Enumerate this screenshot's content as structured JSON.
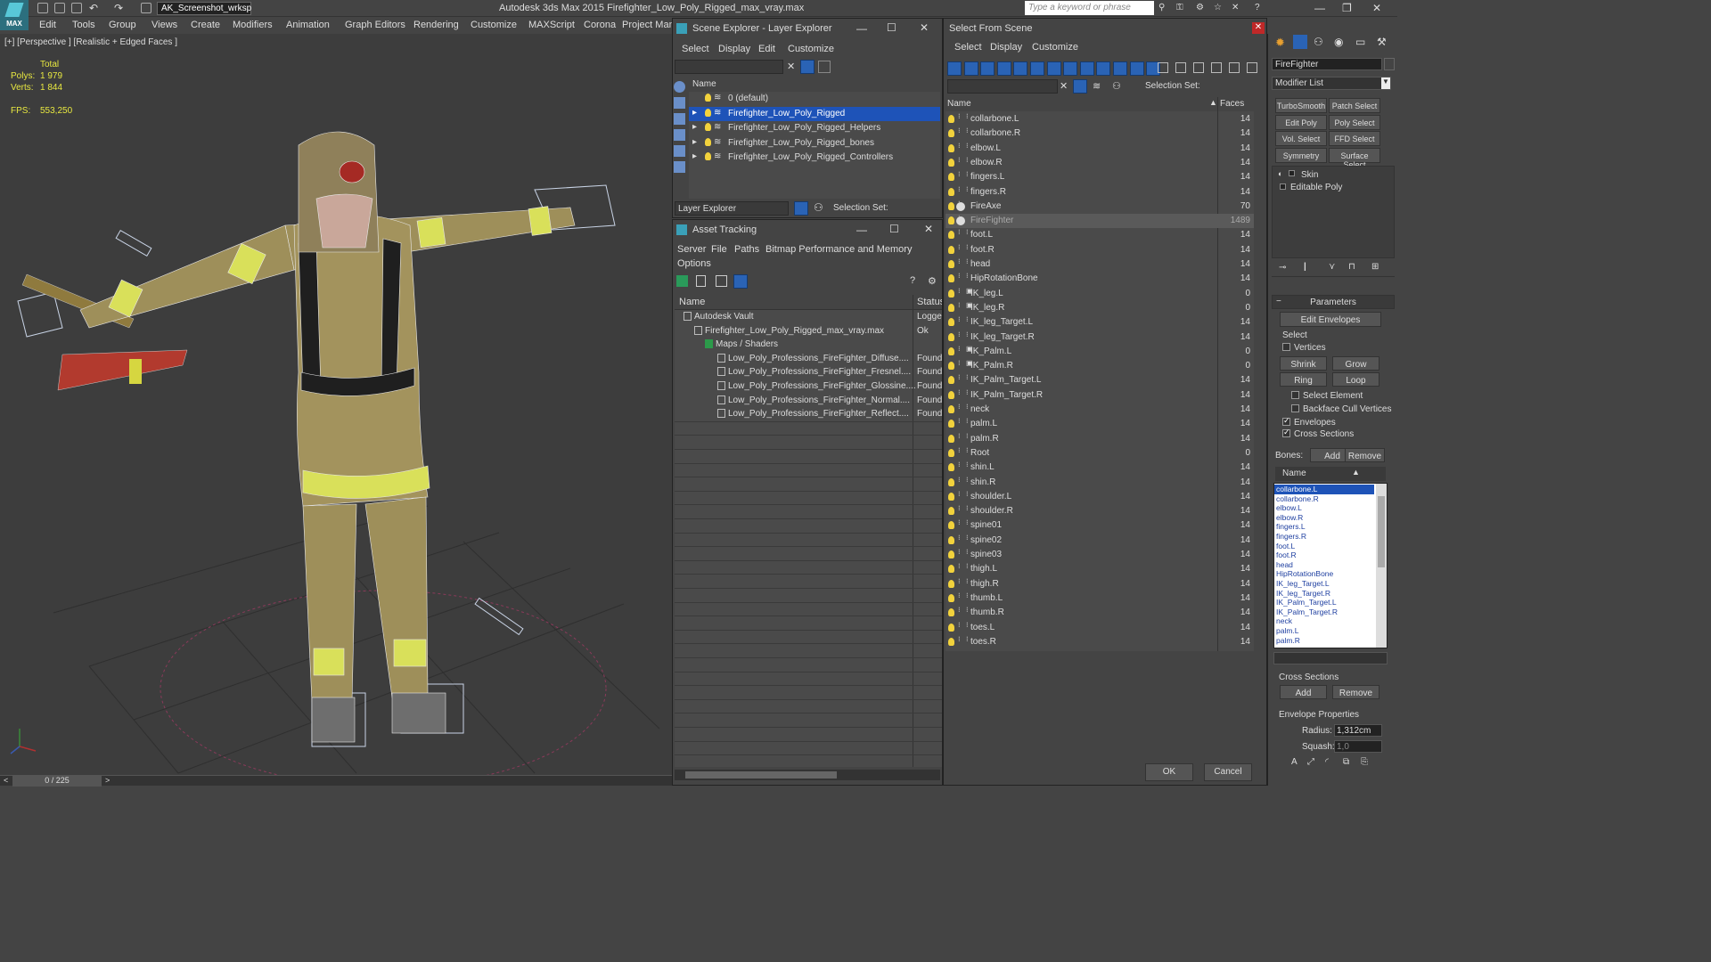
{
  "app": {
    "title": "Autodesk 3ds Max  2015     Firefighter_Low_Poly_Rigged_max_vray.max",
    "workspace": "AK_Screenshot_wrksp",
    "search_placeholder": "Type a keyword or phrase",
    "logo": "MAX"
  },
  "menu": [
    "Edit",
    "Tools",
    "Group",
    "Views",
    "Create",
    "Modifiers",
    "Animation",
    "Graph Editors",
    "Rendering",
    "Customize",
    "MAXScript",
    "Corona",
    "Project Man"
  ],
  "viewport": {
    "label": "[+] [Perspective ] [Realistic + Edged Faces ]",
    "total_label": "Total",
    "polys_label": "Polys:",
    "polys_value": "1 979",
    "verts_label": "Verts:",
    "verts_value": "1 844",
    "fps_label": "FPS:",
    "fps_value": "553,250"
  },
  "timeline": {
    "frame": "0 / 225",
    "prev": "<",
    "next": ">"
  },
  "scene_explorer": {
    "title": "Scene Explorer - Layer Explorer",
    "menu": [
      "Select",
      "Display",
      "Edit",
      "Customize"
    ],
    "column": "Name",
    "layers": [
      "0 (default)",
      "Firefighter_Low_Poly_Rigged",
      "Firefighter_Low_Poly_Rigged_Helpers",
      "Firefighter_Low_Poly_Rigged_bones",
      "Firefighter_Low_Poly_Rigged_Controllers"
    ],
    "footer_dropdown": "Layer Explorer",
    "selection_set": "Selection Set:"
  },
  "asset_tracking": {
    "title": "Asset Tracking",
    "menu": [
      "Server",
      "File",
      "Paths",
      "Bitmap Performance and Memory",
      "Options"
    ],
    "col_name": "Name",
    "col_status": "Status",
    "rows": [
      {
        "name": "Autodesk Vault",
        "status": "Logge"
      },
      {
        "name": "Firefighter_Low_Poly_Rigged_max_vray.max",
        "status": "Ok"
      },
      {
        "name": "Maps / Shaders",
        "status": ""
      },
      {
        "name": "Low_Poly_Professions_FireFighter_Diffuse....",
        "status": "Found"
      },
      {
        "name": "Low_Poly_Professions_FireFighter_Fresnel....",
        "status": "Found"
      },
      {
        "name": "Low_Poly_Professions_FireFighter_Glossine....",
        "status": "Found"
      },
      {
        "name": "Low_Poly_Professions_FireFighter_Normal....",
        "status": "Found"
      },
      {
        "name": "Low_Poly_Professions_FireFighter_Reflect....",
        "status": "Found"
      }
    ]
  },
  "select_from_scene": {
    "title": "Select From Scene",
    "menu": [
      "Select",
      "Display",
      "Customize"
    ],
    "selection_set": "Selection Set:",
    "col_name": "Name",
    "col_faces": "Faces",
    "rows": [
      {
        "name": "collarbone.L",
        "faces": "14"
      },
      {
        "name": "collarbone.R",
        "faces": "14"
      },
      {
        "name": "elbow.L",
        "faces": "14"
      },
      {
        "name": "elbow.R",
        "faces": "14"
      },
      {
        "name": "fingers.L",
        "faces": "14"
      },
      {
        "name": "fingers.R",
        "faces": "14"
      },
      {
        "name": "FireAxe",
        "faces": "70"
      },
      {
        "name": "FireFighter",
        "faces": "1489"
      },
      {
        "name": "foot.L",
        "faces": "14"
      },
      {
        "name": "foot.R",
        "faces": "14"
      },
      {
        "name": "head",
        "faces": "14"
      },
      {
        "name": "HipRotationBone",
        "faces": "14"
      },
      {
        "name": "IK_leg.L",
        "faces": "0"
      },
      {
        "name": "IK_leg.R",
        "faces": "0"
      },
      {
        "name": "IK_leg_Target.L",
        "faces": "14"
      },
      {
        "name": "IK_leg_Target.R",
        "faces": "14"
      },
      {
        "name": "IK_Palm.L",
        "faces": "0"
      },
      {
        "name": "IK_Palm.R",
        "faces": "0"
      },
      {
        "name": "IK_Palm_Target.L",
        "faces": "14"
      },
      {
        "name": "IK_Palm_Target.R",
        "faces": "14"
      },
      {
        "name": "neck",
        "faces": "14"
      },
      {
        "name": "palm.L",
        "faces": "14"
      },
      {
        "name": "palm.R",
        "faces": "14"
      },
      {
        "name": "Root",
        "faces": "0"
      },
      {
        "name": "shin.L",
        "faces": "14"
      },
      {
        "name": "shin.R",
        "faces": "14"
      },
      {
        "name": "shoulder.L",
        "faces": "14"
      },
      {
        "name": "shoulder.R",
        "faces": "14"
      },
      {
        "name": "spine01",
        "faces": "14"
      },
      {
        "name": "spine02",
        "faces": "14"
      },
      {
        "name": "spine03",
        "faces": "14"
      },
      {
        "name": "thigh.L",
        "faces": "14"
      },
      {
        "name": "thigh.R",
        "faces": "14"
      },
      {
        "name": "thumb.L",
        "faces": "14"
      },
      {
        "name": "thumb.R",
        "faces": "14"
      },
      {
        "name": "toes.L",
        "faces": "14"
      },
      {
        "name": "toes.R",
        "faces": "14"
      }
    ],
    "ok": "OK",
    "cancel": "Cancel"
  },
  "command_panel": {
    "object_name": "FireFighter",
    "modifier_list": "Modifier List",
    "modifier_buttons": [
      "TurboSmooth",
      "Patch Select",
      "Edit Poly",
      "Poly Select",
      "Vol. Select",
      "FFD Select",
      "Symmetry",
      "Surface Select"
    ],
    "stack": [
      "Skin",
      "Editable Poly"
    ],
    "parameters": "Parameters",
    "edit_envelopes": "Edit Envelopes",
    "select_label": "Select",
    "vertices": "Vertices",
    "shrink": "Shrink",
    "grow": "Grow",
    "ring": "Ring",
    "loop": "Loop",
    "select_element": "Select Element",
    "backface_cull": "Backface Cull Vertices",
    "envelopes": "Envelopes",
    "cross_sections": "Cross Sections",
    "bones_label": "Bones:",
    "add": "Add",
    "remove": "Remove",
    "name_col": "Name",
    "bones": [
      "collarbone.L",
      "collarbone.R",
      "elbow.L",
      "elbow.R",
      "fingers.L",
      "fingers.R",
      "foot.L",
      "foot.R",
      "head",
      "HipRotationBone",
      "IK_leg_Target.L",
      "IK_leg_Target.R",
      "IK_Palm_Target.L",
      "IK_Palm_Target.R",
      "neck",
      "palm.L",
      "palm.R"
    ],
    "cross_sections_group": "Cross Sections",
    "cs_add": "Add",
    "cs_remove": "Remove",
    "envelope_props": "Envelope Properties",
    "radius_label": "Radius:",
    "radius_value": "1,312cm",
    "squash_label": "Squash:",
    "squash_value": "1,0"
  },
  "colors": {
    "selection": "#1e53b8",
    "bulb": "#f2d23c",
    "stats": "#e8e840",
    "viewport_bg": "#3d3d3d"
  }
}
